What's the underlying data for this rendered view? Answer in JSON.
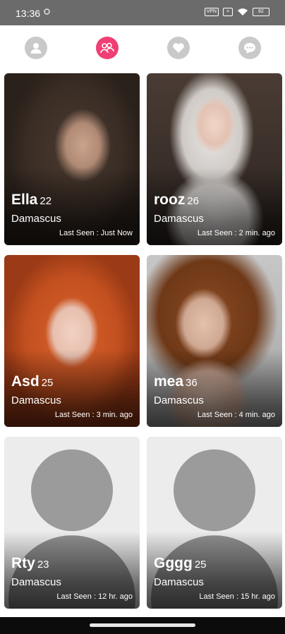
{
  "status_bar": {
    "time": "13:36",
    "vpn_label": "VPN",
    "battery_label": "82"
  },
  "tabs": [
    {
      "name": "profile",
      "icon": "person-icon",
      "active": false
    },
    {
      "name": "people",
      "icon": "group-icon",
      "active": true
    },
    {
      "name": "favorites",
      "icon": "heart-icon",
      "active": false
    },
    {
      "name": "messages",
      "icon": "chat-icon",
      "active": false
    }
  ],
  "accent_color": "#ef3f74",
  "profiles": [
    {
      "name": "Ella",
      "age": "22",
      "city": "Damascus",
      "last_seen": "Last Seen : Just Now"
    },
    {
      "name": "rooz",
      "age": "26",
      "city": "Damascus",
      "last_seen": "Last Seen : 2 min. ago"
    },
    {
      "name": "Asd",
      "age": "25",
      "city": "Damascus",
      "last_seen": "Last Seen : 3 min. ago"
    },
    {
      "name": "mea",
      "age": "36",
      "city": "Damascus",
      "last_seen": "Last Seen : 4 min. ago"
    },
    {
      "name": "Rty",
      "age": "23",
      "city": "Damascus",
      "last_seen": "Last Seen : 12 hr. ago"
    },
    {
      "name": "Gggg",
      "age": "25",
      "city": "Damascus",
      "last_seen": "Last Seen : 15 hr. ago"
    }
  ]
}
